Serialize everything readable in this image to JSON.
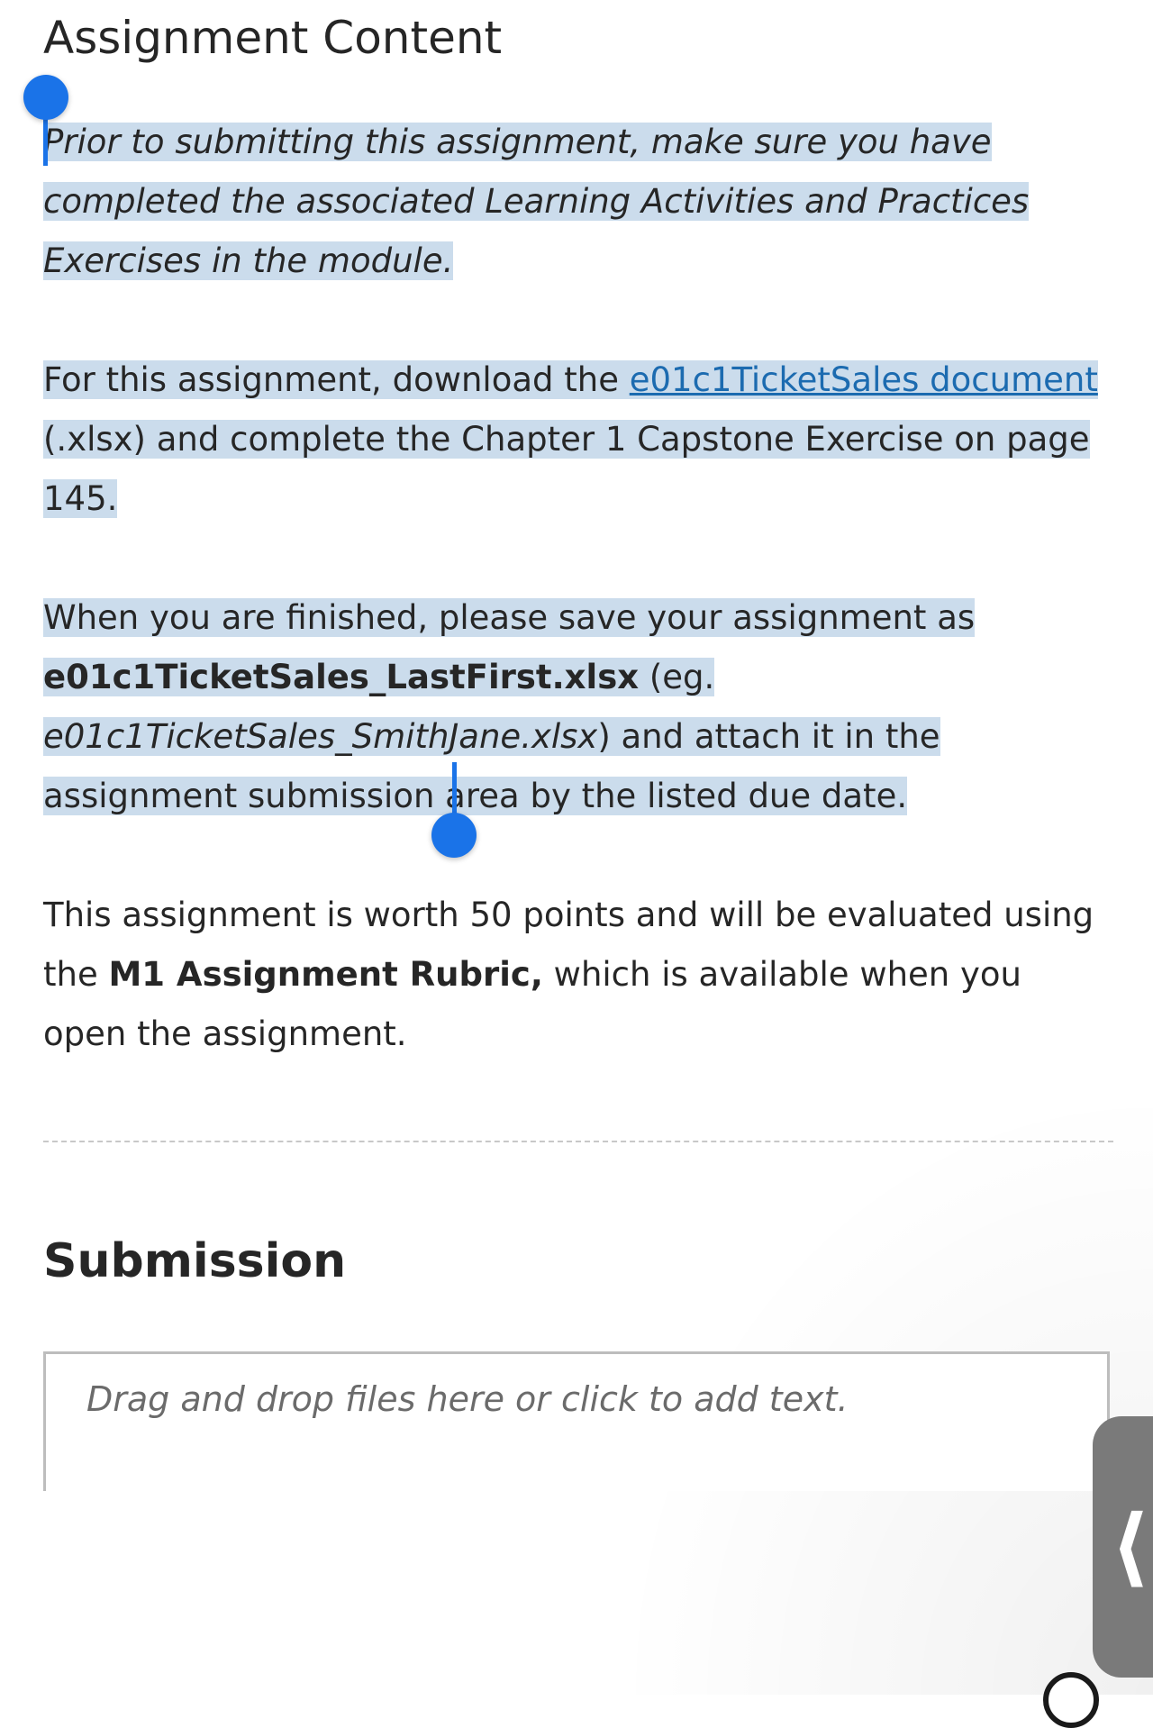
{
  "header": {
    "title": "Assignment Content"
  },
  "intro": {
    "text": "Prior to submitting this assignment, make sure you have completed the associated Learning Activities and Practices Exercises in the module."
  },
  "download": {
    "prefix": "For this assignment, download the ",
    "link_text": "e01c1TicketSales document",
    "suffix": " (.xlsx) and complete the Chapter 1 Capstone Exercise on page 145."
  },
  "save": {
    "prefix": "When you are finished, please save your assignment as ",
    "filename": "e01c1TicketSales_LastFirst.xlsx",
    "eg_open": " (eg. ",
    "example": "e01c1TicketSales_SmithJane.xlsx",
    "suffix": ") and attach it in the assignment submission area by the listed due date."
  },
  "worth": {
    "prefix": "This assignment is worth 50 points and will be evaluated using the ",
    "rubric": "M1 Assignment Rubric,",
    "suffix": " which is available when you open the assignment."
  },
  "submission": {
    "title": "Submission",
    "placeholder": "Drag and drop files here or click to add text."
  },
  "icons": {
    "side_tab": "chevron-left-icon",
    "help": "help-icon"
  },
  "colors": {
    "selection": "#cbdcec",
    "handle": "#1a73e8",
    "link": "#1c6bb0"
  }
}
